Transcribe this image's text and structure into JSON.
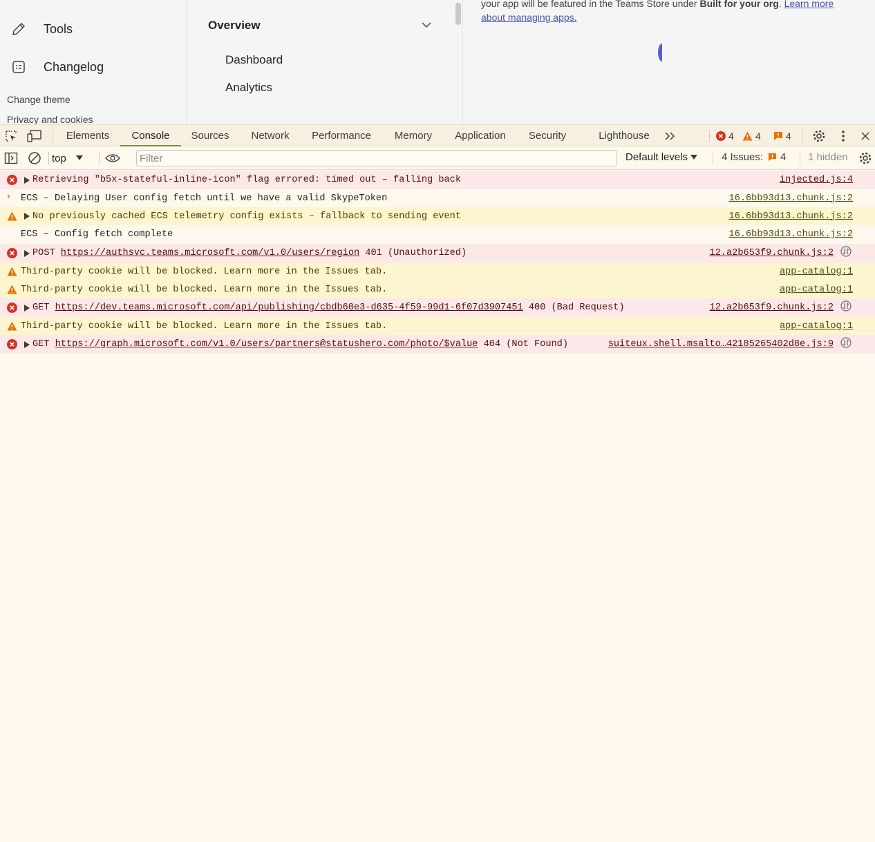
{
  "app": {
    "nav": {
      "tools_label": "Tools",
      "changelog_label": "Changelog",
      "change_theme_label": "Change theme",
      "privacy_label": "Privacy and cookies"
    },
    "menu": {
      "overview_label": "Overview",
      "items": [
        "Dashboard",
        "Analytics"
      ]
    },
    "content": {
      "text_prefix": "your app will be featured in the Teams Store under ",
      "bold_text": "Built for your org",
      "text_suffix": ". ",
      "link_text": "Learn more about managing apps."
    }
  },
  "devtools": {
    "tabs": [
      "Elements",
      "Console",
      "Sources",
      "Network",
      "Performance",
      "Memory",
      "Application",
      "Security",
      "Lighthouse"
    ],
    "active_tab": "Console",
    "counts": {
      "errors": "4",
      "warnings": "4",
      "issues": "4"
    },
    "toolbar": {
      "context": "top",
      "filter_placeholder": "Filter",
      "levels": "Default levels",
      "issues_label": "4 Issues:",
      "issues_count": "4",
      "hidden": "1 hidden"
    },
    "colors": {
      "error": "#d93025",
      "warning": "#e8710a",
      "accent": "#5b5fc7"
    },
    "messages": [
      {
        "level": "error",
        "expandable": true,
        "text": "Retrieving \"b5x-stateful-inline-icon\" flag errored: timed out – falling back",
        "source": "injected.js:4",
        "net": false
      },
      {
        "level": "info",
        "expandable": false,
        "text": "ECS – Delaying User config fetch until we have a valid SkypeToken",
        "source": "16.6bb93d13.chunk.js:2",
        "net": false
      },
      {
        "level": "warning",
        "expandable": true,
        "text": "No previously cached ECS telemetry config exists – fallback to sending event",
        "source": "16.6bb93d13.chunk.js:2",
        "net": false
      },
      {
        "level": "info",
        "expandable": false,
        "text": "ECS – Config fetch complete",
        "source": "16.6bb93d13.chunk.js:2",
        "net": false
      },
      {
        "level": "error",
        "expandable": true,
        "method": "POST ",
        "url": "https://authsvc.teams.microsoft.com/v1.0/users/region",
        "status": " 401 (Unauthorized)",
        "source": "12.a2b653f9.chunk.js:2",
        "net": true
      },
      {
        "level": "warning",
        "expandable": false,
        "text": "Third-party cookie will be blocked. Learn more in the Issues tab.",
        "source": "app-catalog:1",
        "net": false
      },
      {
        "level": "warning",
        "expandable": false,
        "text": "Third-party cookie will be blocked. Learn more in the Issues tab.",
        "source": "app-catalog:1",
        "net": false
      },
      {
        "level": "error",
        "expandable": true,
        "method": "GET ",
        "url": "https://dev.teams.microsoft.com/api/publishing/cbdb60e3-d635-4f59-99d1-6f07d3907451",
        "status": " 400 (Bad Request)",
        "source": "12.a2b653f9.chunk.js:2",
        "net": true
      },
      {
        "level": "warning",
        "expandable": false,
        "text": "Third-party cookie will be blocked. Learn more in the Issues tab.",
        "source": "app-catalog:1",
        "net": false
      },
      {
        "level": "error",
        "expandable": true,
        "method": "GET ",
        "url": "https://graph.microsoft.com/v1.0/users/partners@statushero.com/photo/$value",
        "status": " 404 (Not Found)",
        "source": "suiteux.shell.msalto…42185265402d8e.js:9",
        "net": true
      }
    ],
    "prompt_symbol": "›"
  }
}
